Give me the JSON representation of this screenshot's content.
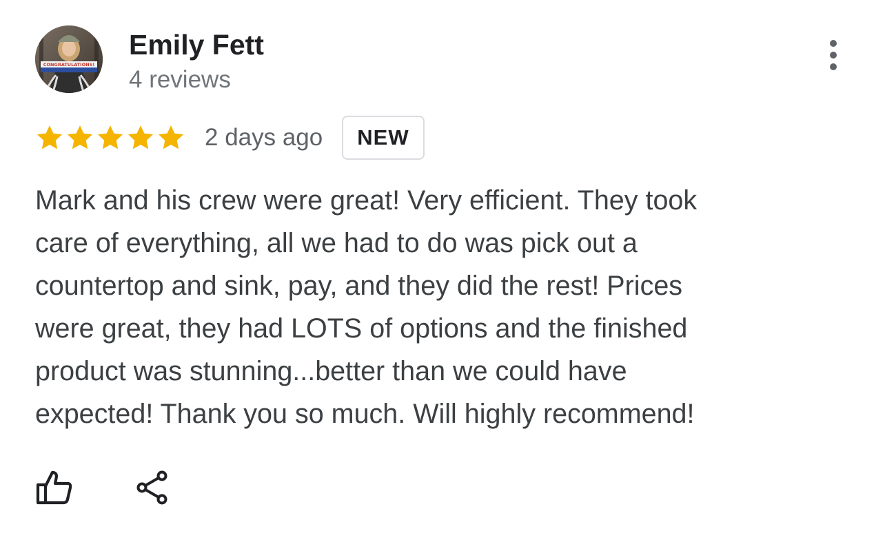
{
  "review": {
    "author": {
      "name": "Emily Fett",
      "review_count": "4 reviews",
      "avatar_icon": "user-avatar-photo"
    },
    "rating": 5,
    "rating_max": 5,
    "star_color": "#f4b400",
    "date": "2 days ago",
    "badge": "NEW",
    "text": "Mark and his crew were great! Very efficient. They took\ncare of everything, all we had to do was pick out a\ncountertop and sink, pay, and they did the rest!  Prices\nwere great, they had LOTS of options and the finished\nproduct was stunning...better than we could have\nexpected! Thank you so much. Will highly recommend!",
    "avatar_banner": "CONGRATULATIONS!"
  },
  "actions": {
    "like_icon": "thumbs-up-icon",
    "share_icon": "share-icon",
    "more_icon": "more-vert-icon"
  }
}
